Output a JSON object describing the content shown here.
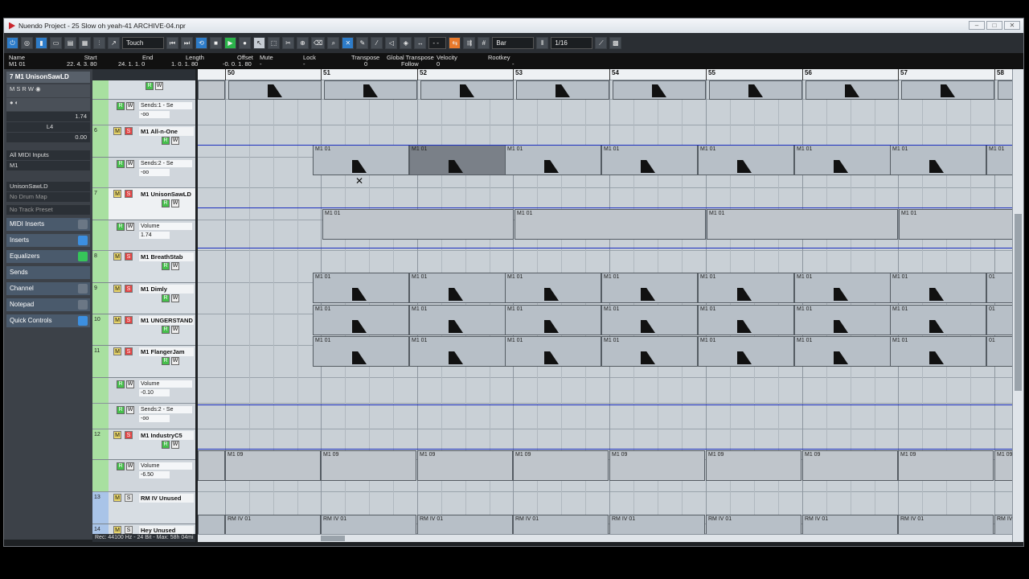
{
  "window": {
    "title": "Nuendo Project - 25 Slow oh yeah-41 ARCHIVE-04.npr"
  },
  "toolbar": {
    "automation_mode": "Touch",
    "grid_type": "Bar",
    "quantize": "1/16",
    "nudge_label": "- -"
  },
  "infoline": {
    "name_label": "Name",
    "name_value": "M1 01",
    "start_label": "Start",
    "start_value": "22. 4. 3. 80",
    "end_label": "End",
    "end_value": "24. 1. 1.  0",
    "length_label": "Length",
    "length_value": "1. 0. 1. 80",
    "offset_label": "Offset",
    "offset_value": "-0. 0. 1. 80",
    "mute_label": "Mute",
    "mute_value": "-",
    "lock_label": "Lock",
    "lock_value": "-",
    "transpose_label": "Transpose",
    "transpose_value": "0",
    "global_transpose_label": "Global Transpose",
    "global_transpose_value": "Follow",
    "velocity_label": "Velocity",
    "velocity_value": "0",
    "rootkey_label": "Rootkey",
    "rootkey_value": "-"
  },
  "inspector": {
    "track_name": "M1 UnisonSawLD",
    "track_number": "7",
    "volume_value": "1.74",
    "pan_value": "L4",
    "delay_value": "0.00",
    "input": "All MIDI Inputs",
    "output": "M1",
    "program": "UnisonSawLD",
    "drum_map": "No Drum Map",
    "track_preset": "No Track Preset",
    "sections": [
      "MIDI Inserts",
      "Inserts",
      "Equalizers",
      "Sends",
      "Channel",
      "Notepad",
      "Quick Controls"
    ]
  },
  "tracks": [
    {
      "num": "",
      "name": "M1 UnisonSawLD",
      "lane_param": "Sends:1 - Se",
      "lane_value": "-oo"
    },
    {
      "num": "6",
      "name": "M1 All-n-One",
      "lane_param": "Sends:2 - Se",
      "lane_value": "-oo"
    },
    {
      "num": "7",
      "name": "M1 UnisonSawLD",
      "lane_param": "Volume",
      "lane_value": "1.74"
    },
    {
      "num": "8",
      "name": "M1 BreathStab"
    },
    {
      "num": "9",
      "name": "M1 Dimly"
    },
    {
      "num": "10",
      "name": "M1 UNGERSTAND"
    },
    {
      "num": "11",
      "name": "M1 FlangerJam",
      "lane_param": "Volume",
      "lane_value": "-0.10",
      "lane2_param": "Sends:2 - Se",
      "lane2_value": "-oo"
    },
    {
      "num": "12",
      "name": "M1 IndustryC5",
      "lane_param": "Volume",
      "lane_value": "-6.50"
    },
    {
      "num": "13",
      "name": "RM IV Unused"
    },
    {
      "num": "14",
      "name": "Hey Unused"
    }
  ],
  "status": {
    "text": "Rec: 44100 Hz - 24 Bit - Max: 58h 04mi"
  },
  "ruler": {
    "bars": [
      "50",
      "51",
      "52",
      "53",
      "54",
      "55",
      "56",
      "57",
      "58"
    ]
  },
  "parts": {
    "m1": "M1 01",
    "m1_short": "01",
    "m9": "M1 09",
    "rm": "RM IV 01",
    "rm_short": "RM IV"
  }
}
